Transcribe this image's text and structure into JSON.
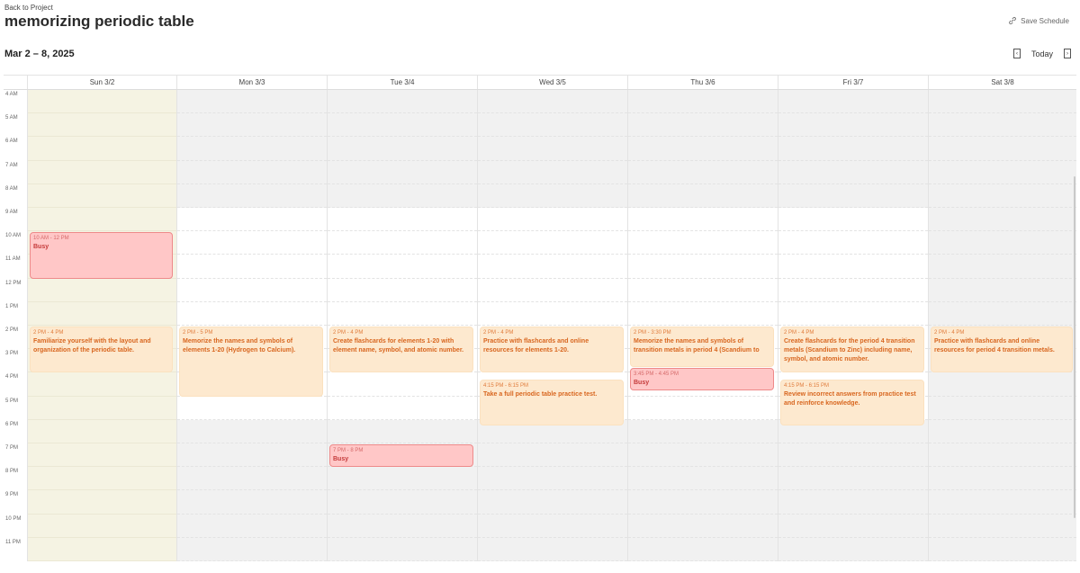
{
  "back_link": "Back to Project",
  "title": "memorizing periodic table",
  "save_label": "Save Schedule",
  "date_range": "Mar 2 – 8, 2025",
  "nav": {
    "today_label": "Today",
    "prev_glyph": "‹",
    "next_glyph": "›"
  },
  "days": [
    {
      "label": "Sun 3/2",
      "events": [
        {
          "time": "10 AM - 12 PM",
          "title": "Busy",
          "kind": "busy",
          "start": 10,
          "end": 12
        },
        {
          "time": "2 PM - 4 PM",
          "title": "Familiarize yourself with the layout and organization of the periodic table.",
          "kind": "task",
          "start": 14,
          "end": 16
        }
      ]
    },
    {
      "label": "Mon 3/3",
      "events": [
        {
          "time": "2 PM - 5 PM",
          "title": "Memorize the names and symbols of elements 1-20 (Hydrogen to Calcium).",
          "kind": "task",
          "start": 14,
          "end": 17
        }
      ]
    },
    {
      "label": "Tue 3/4",
      "events": [
        {
          "time": "2 PM - 4 PM",
          "title": "Create flashcards for elements 1-20 with element name, symbol, and atomic number.",
          "kind": "task",
          "start": 14,
          "end": 16
        },
        {
          "time": "7 PM - 8 PM",
          "title": "Busy",
          "kind": "busy",
          "start": 19,
          "end": 20
        }
      ]
    },
    {
      "label": "Wed 3/5",
      "events": [
        {
          "time": "2 PM - 4 PM",
          "title": "Practice with flashcards and online resources for elements 1-20.",
          "kind": "task",
          "start": 14,
          "end": 16
        },
        {
          "time": "4:15 PM - 6:15 PM",
          "title": "Take a full periodic table practice test.",
          "kind": "task",
          "start": 16.25,
          "end": 18.25
        }
      ]
    },
    {
      "label": "Thu 3/6",
      "events": [
        {
          "time": "2 PM - 3:30 PM",
          "title": "Memorize the names and symbols of transition metals in period 4 (Scandium to",
          "kind": "task",
          "start": 14,
          "end": 15.75
        },
        {
          "time": "3:45 PM - 4:45 PM",
          "title": "Busy",
          "kind": "busy",
          "start": 15.75,
          "end": 16.75
        }
      ]
    },
    {
      "label": "Fri 3/7",
      "events": [
        {
          "time": "2 PM - 4 PM",
          "title": "Create flashcards for the period 4 transition metals (Scandium to Zinc) including name, symbol, and atomic number.",
          "kind": "task",
          "start": 14,
          "end": 16
        },
        {
          "time": "4:15 PM - 6:15 PM",
          "title": "Review incorrect answers from practice test and reinforce knowledge.",
          "kind": "task",
          "start": 16.25,
          "end": 18.25
        }
      ]
    },
    {
      "label": "Sat 3/8",
      "events": [
        {
          "time": "2 PM - 4 PM",
          "title": "Practice with flashcards and online resources for period 4 transition metals.",
          "kind": "task",
          "start": 14,
          "end": 16
        }
      ]
    }
  ],
  "hours": [
    "4 AM",
    "5 AM",
    "6 AM",
    "7 AM",
    "8 AM",
    "9 AM",
    "10 AM",
    "11 AM",
    "12 PM",
    "1 PM",
    "2 PM",
    "3 PM",
    "4 PM",
    "5 PM",
    "6 PM",
    "7 PM",
    "8 PM",
    "9 PM",
    "10 PM",
    "11 PM"
  ],
  "first_hour": 4,
  "available_hours": {
    "start": 9,
    "end": 18
  },
  "colors": {
    "task_bg": "#fde9cf",
    "task_text": "#d8661f",
    "busy_bg": "#ffc7c7",
    "busy_border": "#ee8a8a",
    "busy_text": "#c53a3a",
    "sunday_bg": "#f5f3e3",
    "unavailable_bg": "#f1f1f1"
  }
}
